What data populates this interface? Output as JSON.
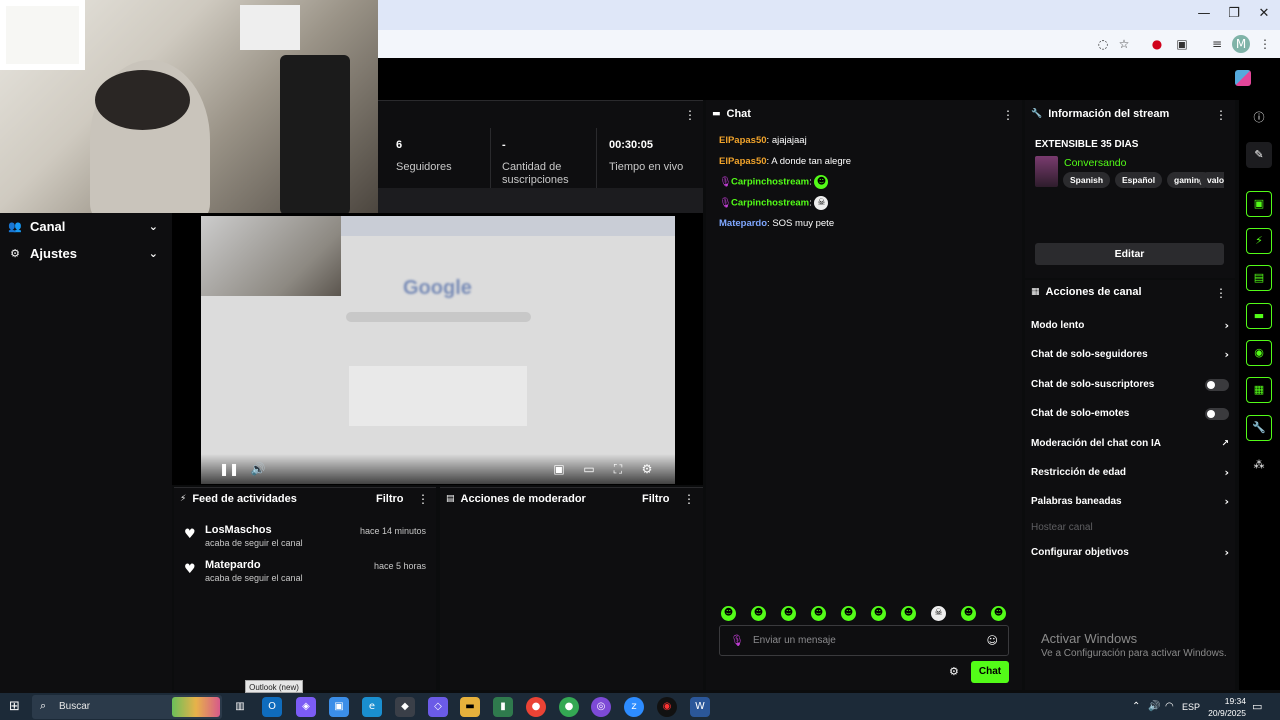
{
  "browser": {
    "window_controls": [
      "—",
      "❐",
      "✕"
    ],
    "icons": [
      "eye-off-icon",
      "star-icon",
      "opera-icon",
      "extensions-icon",
      "playlist-icon",
      "profile-avatar",
      "kebab-menu-icon"
    ],
    "profile_letter": "M"
  },
  "sidebar": {
    "items": [
      {
        "label": "Canal",
        "icon": "users-icon"
      },
      {
        "label": "Ajustes",
        "icon": "gear-icon"
      }
    ]
  },
  "stats": {
    "items": [
      {
        "value": "6",
        "label": "Seguidores"
      },
      {
        "value": "-",
        "label": "Cantidad de suscripciones"
      },
      {
        "value": "00:30:05",
        "label": "Tiempo en vivo"
      }
    ]
  },
  "video_preview": {
    "inner_logo": "Google"
  },
  "activity_feed": {
    "title": "Feed de actividades",
    "filter": "Filtro",
    "items": [
      {
        "name": "LosMaschos",
        "action": "acaba de seguir el canal",
        "time": "hace 14 minutos"
      },
      {
        "name": "Matepardo",
        "action": "acaba de seguir el canal",
        "time": "hace 5 horas"
      }
    ]
  },
  "moderator_actions": {
    "title": "Acciones de moderador",
    "filter": "Filtro"
  },
  "chat": {
    "title": "Chat",
    "messages": [
      {
        "user": "ElPapas50",
        "text": ": ajajajaaj",
        "color": "#f0a32b"
      },
      {
        "user": "ElPapas50",
        "text": ": A donde tan alegre",
        "color": "#f0a32b"
      },
      {
        "user": "Carpinchostream",
        "text": ":",
        "color": "#53fc18",
        "emote": "alien-emote"
      },
      {
        "user": "Carpinchostream",
        "text": ":",
        "color": "#53fc18",
        "emote": "skull-emote"
      },
      {
        "user": "Matepardo",
        "text": ": SOS muy pete",
        "color": "#7fa7ff"
      }
    ],
    "input_placeholder": "Enviar un mensaje",
    "send_label": "Chat"
  },
  "stream_info": {
    "title": "Información del stream",
    "stream_title": "EXTENSIBLE 35 DIAS",
    "category": "Conversando",
    "tags": [
      "Spanish",
      "Español",
      "gaming",
      "valor"
    ],
    "edit_label": "Editar"
  },
  "channel_actions": {
    "title": "Acciones de canal",
    "items": [
      {
        "label": "Modo lento",
        "control": "arrow"
      },
      {
        "label": "Chat de solo-seguidores",
        "control": "arrow"
      },
      {
        "label": "Chat de solo-suscriptores",
        "control": "toggle"
      },
      {
        "label": "Chat de solo-emotes",
        "control": "toggle"
      },
      {
        "label": "Moderación del chat con IA",
        "control": "external"
      },
      {
        "label": "Restricción de edad",
        "control": "arrow"
      },
      {
        "label": "Palabras baneadas",
        "control": "arrow"
      },
      {
        "label": "Hostear canal",
        "control": "disabled"
      },
      {
        "label": "Configurar objetivos",
        "control": "arrow"
      }
    ]
  },
  "watermark": {
    "line1": "Activar Windows",
    "line2": "Ve a Configuración para activar Windows."
  },
  "taskbar": {
    "search_placeholder": "Buscar",
    "tooltip": "Outlook (new)",
    "language": "ESP",
    "time": "19:34",
    "date": "20/9/2025"
  },
  "colors": {
    "accent": "#53fc18",
    "panel": "#0e0e10",
    "background": "#0b0c0d"
  }
}
